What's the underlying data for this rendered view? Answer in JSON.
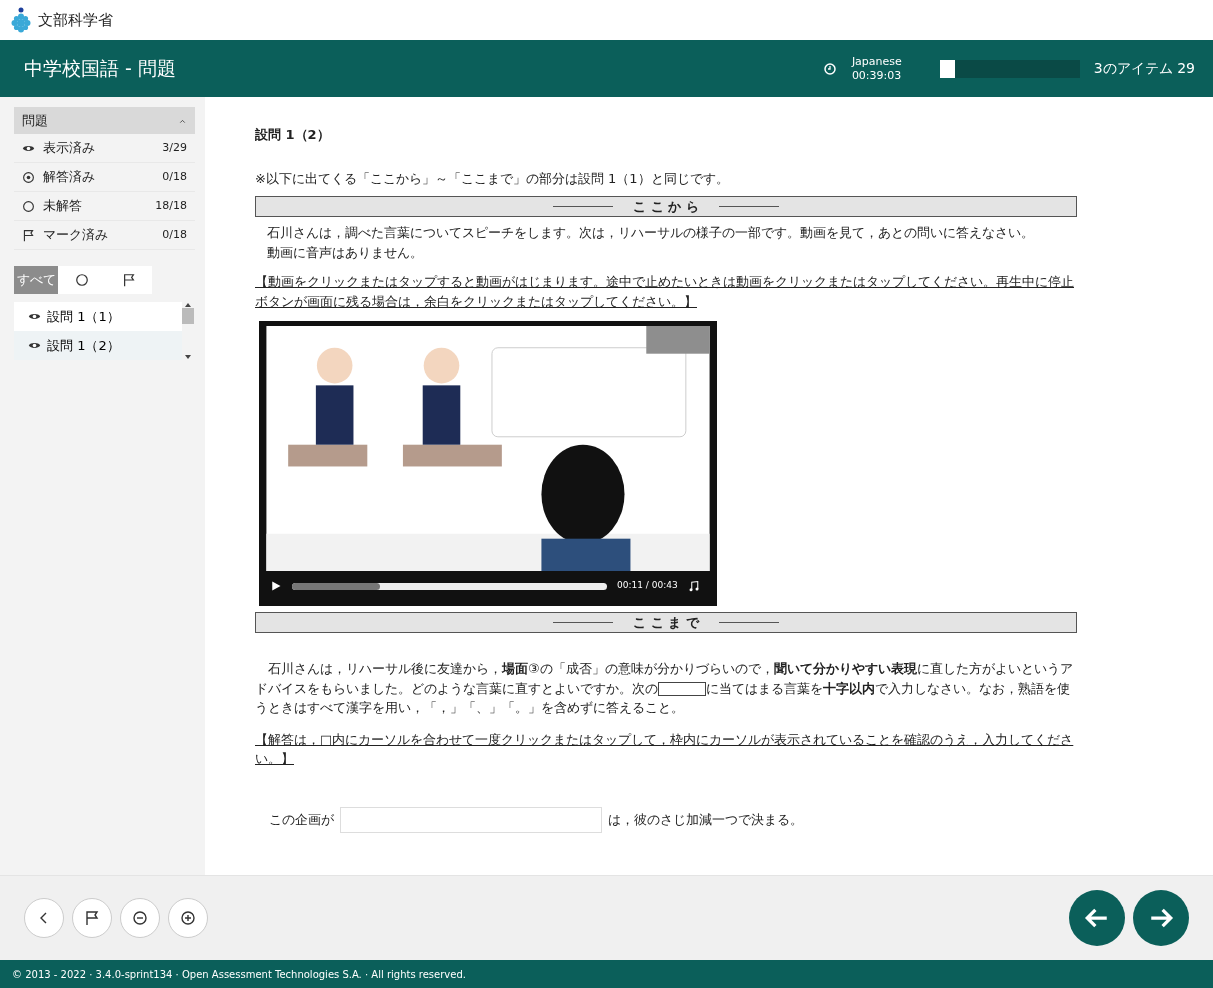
{
  "brand": {
    "name": "文部科学省"
  },
  "header": {
    "title": "中学校国語 - 問題",
    "timer_label": "Japanese",
    "timer": "00:39:03",
    "progress": {
      "level": 0.11
    },
    "progress_text": "3のアイテム 29"
  },
  "sidebar": {
    "section_title": "問題",
    "expanded": true,
    "stats": [
      {
        "kind": "viewed",
        "label": "表示済み",
        "count": "3/29"
      },
      {
        "kind": "answered",
        "label": "解答済み",
        "count": "0/18"
      },
      {
        "kind": "unanswered",
        "label": "未解答",
        "count": "18/18"
      },
      {
        "kind": "flagged",
        "label": "マーク済み",
        "count": "0/18"
      }
    ],
    "filters": [
      {
        "label": "すべて",
        "selected": true
      },
      {
        "kind": "unanswered",
        "selected": false
      },
      {
        "kind": "flagged",
        "selected": false
      }
    ],
    "items": [
      {
        "label": "設問 1（1）",
        "selected": false
      },
      {
        "label": "設問 1（2）",
        "selected": true
      }
    ]
  },
  "question": {
    "title": "設問 1（2）",
    "note": "※以下に出てくる「ここから」～「ここまで」の部分は設問 1（1）と同じです。",
    "start_marker": "こ こ か ら",
    "intro": [
      "石川さんは，調べた言葉についてスピーチをします。次は，リハーサルの様子の一部です。動画を見て，あとの問いに答えなさい。",
      "動画に音声はありません。"
    ],
    "video_instruction": "【動画をクリックまたはタップすると動画がはじまります。途中で止めたいときは動画をクリックまたはタップしてください。再生中に停止ボタンが画面に残る場合は，余白をクリックまたはタップしてください。】",
    "video": {
      "position": {
        "level": 0.28
      },
      "time": "00:11 / 00:43"
    },
    "end_marker": "こ こ ま で",
    "prompt_before_blank": "　石川さんは，リハーサル後に友達から，**場面**③の「成否」の意味が分かりづらいので，**聞いて分かりやすい表現**に直した方がよいというアドバイスをもらいました。どのような言葉に直すとよいですか。次の",
    "prompt_after_blank": "に当てはまる言葉を**十字以内**で入力しなさい。なお，熟語を使うときはすべて漢字を用い，「，」「、」「。」を含めずに答えること。",
    "answer_instruction": "【解答は，□内にカーソルを合わせて一度クリックまたはタップして，枠内にカーソルが表示されていることを確認のうえ，入力してください。】",
    "answer_before": "この企画が",
    "answer_after": "は，彼のさじ加減一つで決まる。"
  },
  "toolbar": [
    {
      "kind": "back"
    },
    {
      "kind": "flag"
    },
    {
      "kind": "zoom_out"
    },
    {
      "kind": "zoom_in"
    }
  ],
  "navigation": [
    {
      "kind": "previous"
    },
    {
      "kind": "next"
    }
  ],
  "footer": "© 2013 - 2022 · 3.4.0-sprint134 · Open Assessment Technologies S.A. · All rights reserved."
}
